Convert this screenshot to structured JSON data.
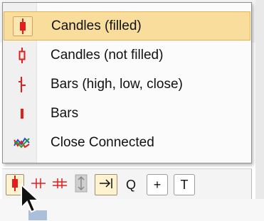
{
  "menu": {
    "items": [
      {
        "label": "Candles (filled)",
        "icon": "candles-filled-icon",
        "active": true
      },
      {
        "label": "Candles (not filled)",
        "icon": "candles-not-filled-icon",
        "active": false
      },
      {
        "label": "Bars (high, low, close)",
        "icon": "bars-hlc-icon",
        "active": false
      },
      {
        "label": "Bars",
        "icon": "bars-icon",
        "active": false
      },
      {
        "label": "Close Connected",
        "icon": "close-connected-icon",
        "active": false
      }
    ]
  },
  "toolbar": {
    "buttons": [
      {
        "icon": "candles-filled-icon"
      },
      {
        "icon": "crosshair-red-icon"
      },
      {
        "icon": "crosshair-alt-icon"
      },
      {
        "icon": "pan-vertical-icon"
      },
      {
        "icon": "scroll-to-end-icon"
      },
      {
        "label": "Q"
      },
      {
        "label": "+"
      },
      {
        "label": "T"
      }
    ]
  },
  "colors": {
    "accent": "#e51c1c",
    "highlight": "#f9dd9d",
    "highlight_border": "#e7b34d"
  }
}
